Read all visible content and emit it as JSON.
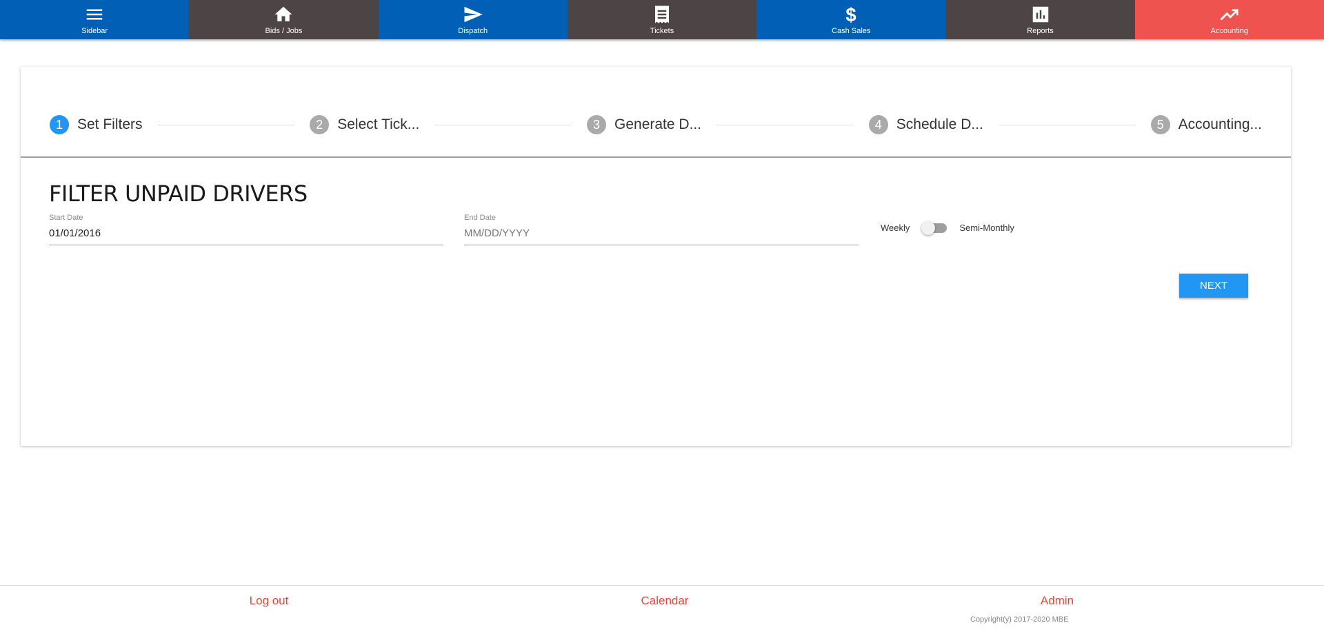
{
  "nav": {
    "items": [
      {
        "label": "Sidebar",
        "icon": "menu-icon",
        "color": "#0160b6"
      },
      {
        "label": "Bids / Jobs",
        "icon": "home-icon",
        "color": "#4d4545"
      },
      {
        "label": "Dispatch",
        "icon": "send-icon",
        "color": "#0160b6"
      },
      {
        "label": "Tickets",
        "icon": "receipt-icon",
        "color": "#4d4545"
      },
      {
        "label": "Cash Sales",
        "icon": "dollar-icon",
        "color": "#0160b6"
      },
      {
        "label": "Reports",
        "icon": "chart-icon",
        "color": "#4d4545"
      },
      {
        "label": "Accounting",
        "icon": "trending-up-icon",
        "color": "#ef5350"
      }
    ]
  },
  "stepper": {
    "steps": [
      {
        "number": "1",
        "label": "Set Filters"
      },
      {
        "number": "2",
        "label": "Select Tick..."
      },
      {
        "number": "3",
        "label": "Generate D..."
      },
      {
        "number": "4",
        "label": "Schedule D..."
      },
      {
        "number": "5",
        "label": "Accounting..."
      }
    ]
  },
  "form": {
    "title": "FILTER UNPAID DRIVERS",
    "start_label": "Start Date",
    "start_value": "01/01/2016",
    "end_label": "End Date",
    "end_placeholder": "MM/DD/YYYY",
    "toggle_left": "Weekly",
    "toggle_right": "Semi-Monthly",
    "next_label": "NEXT"
  },
  "footer": {
    "logout": "Log out",
    "calendar": "Calendar",
    "admin": "Admin",
    "copyright": "Copyright(y) 2017-2020 MBE"
  }
}
